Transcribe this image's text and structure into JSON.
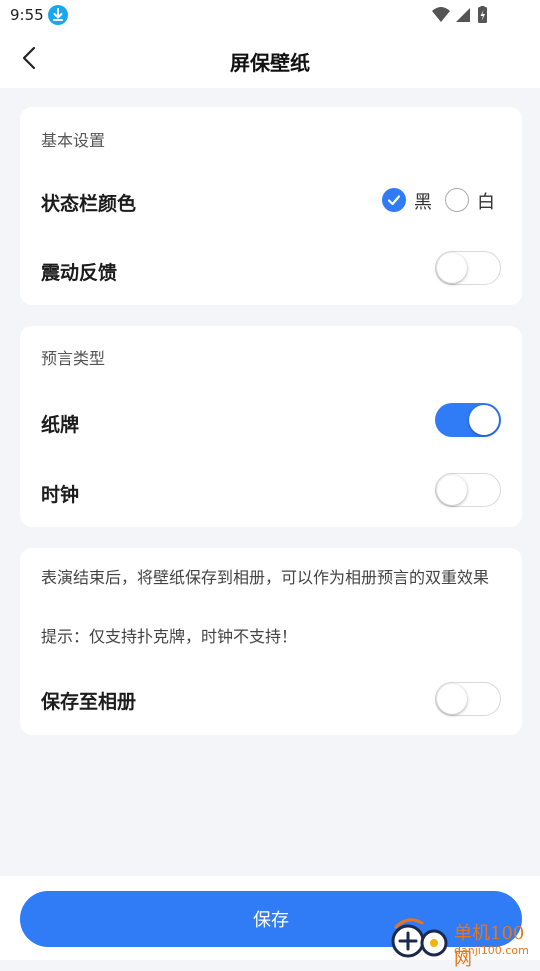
{
  "status_bar": {
    "time": "9:55",
    "icons": [
      "download-badge-icon",
      "wifi-icon",
      "signal-icon",
      "battery-icon"
    ]
  },
  "header": {
    "title": "屏保壁纸",
    "back_icon": "chevron-left-icon"
  },
  "basic_settings": {
    "section_title": "基本设置",
    "status_bar_color": {
      "label": "状态栏颜色",
      "options": [
        {
          "label": "黑",
          "checked": true
        },
        {
          "label": "白",
          "checked": false
        }
      ]
    },
    "vibration": {
      "label": "震动反馈",
      "on": false
    }
  },
  "prediction_type": {
    "section_title": "预言类型",
    "cards": {
      "label": "纸牌",
      "on": true
    },
    "clock": {
      "label": "时钟",
      "on": false
    }
  },
  "album": {
    "description": "表演结束后，将壁纸保存到相册，可以作为相册预言的双重效果",
    "hint": "提示：仅支持扑克牌，时钟不支持！",
    "save_to_album": {
      "label": "保存至相册",
      "on": false
    }
  },
  "footer": {
    "save_label": "保存"
  },
  "watermark": {
    "brand": "单机100网",
    "domain": "danji100.com"
  },
  "colors": {
    "accent": "#2f7cf6",
    "background": "#f4f5f8",
    "card": "#ffffff"
  }
}
